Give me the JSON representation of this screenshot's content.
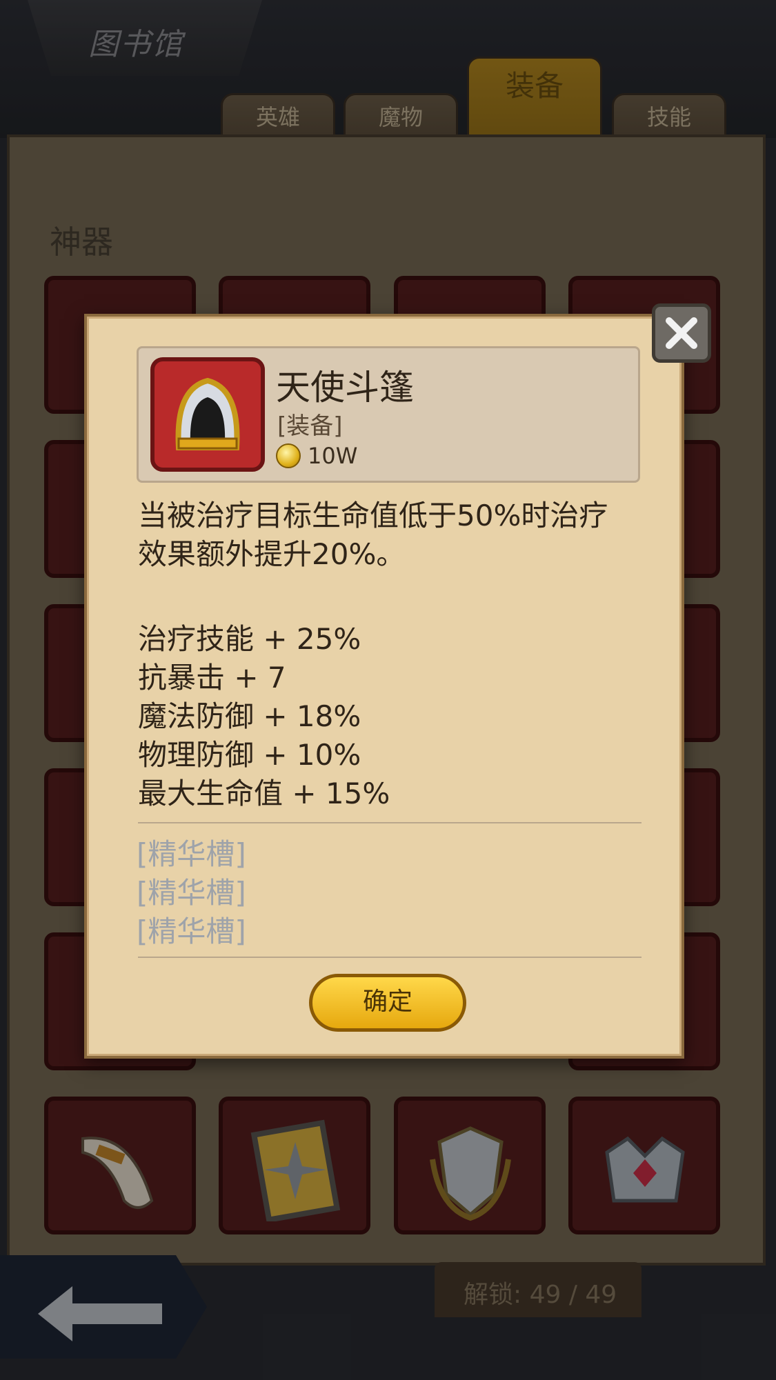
{
  "header": {
    "title": "图书馆"
  },
  "tabs": [
    {
      "label": "英雄"
    },
    {
      "label": "魔物"
    },
    {
      "label": "装备",
      "active": true
    },
    {
      "label": "技能"
    }
  ],
  "section": {
    "title": "神器"
  },
  "footer": {
    "unlock": "解锁: 49 / 49"
  },
  "dialog": {
    "item_name": "天使斗篷",
    "item_type": "[装备]",
    "price": "10W",
    "description": "当被治疗目标生命值低于50%时治疗效果额外提升20%。",
    "stats": [
      "治疗技能 + 25%",
      "抗暴击 + 7",
      "魔法防御 + 18%",
      "物理防御 + 10%",
      "最大生命值 + 15%"
    ],
    "sockets": [
      "[精华槽]",
      "[精华槽]",
      "[精华槽]"
    ],
    "confirm_label": "确定"
  }
}
